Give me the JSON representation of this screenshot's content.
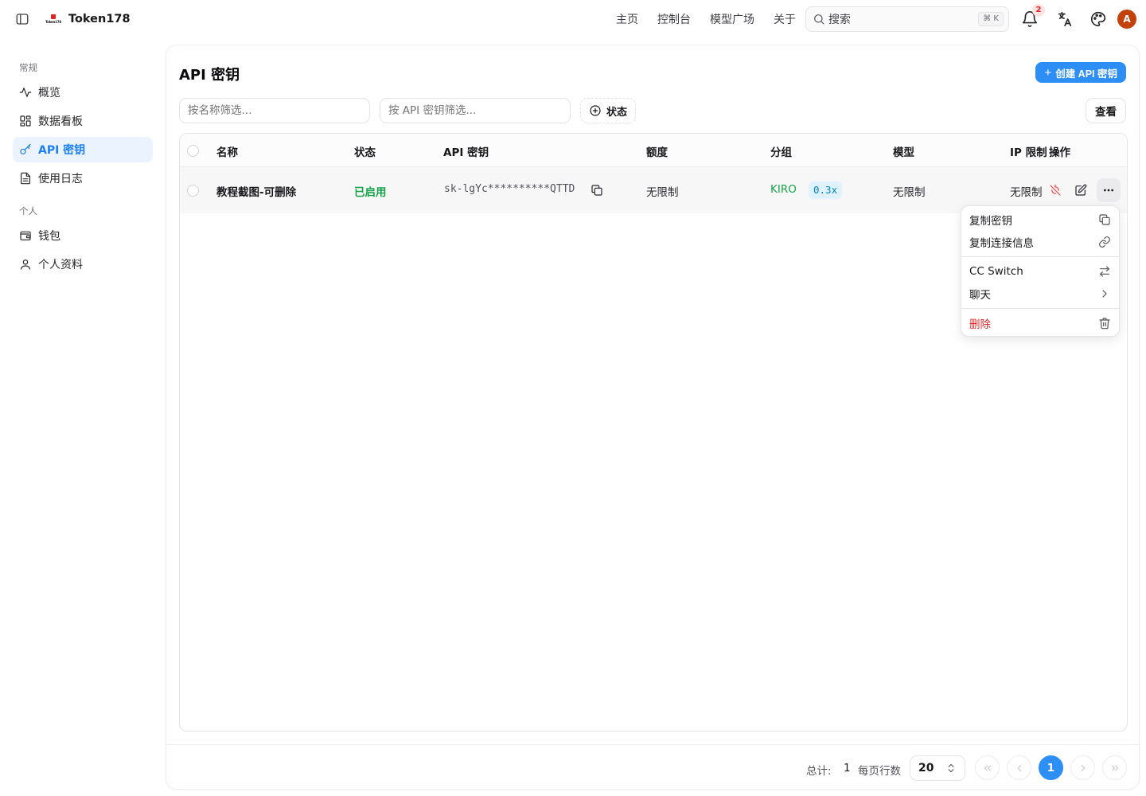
{
  "header": {
    "brand": "Token178",
    "brand_logo_text": "Token178",
    "nav": [
      "主页",
      "控制台",
      "模型广场",
      "关于"
    ],
    "search_placeholder": "搜索",
    "search_shortcut": "⌘ K",
    "notifications_count": "2",
    "avatar_initial": "A"
  },
  "sidebar": {
    "section_general": "常规",
    "section_personal": "个人",
    "items": [
      {
        "label": "概览",
        "icon": "activity-icon"
      },
      {
        "label": "数据看板",
        "icon": "dashboard-icon"
      },
      {
        "label": "API 密钥",
        "icon": "key-icon",
        "active": true
      },
      {
        "label": "使用日志",
        "icon": "file-text-icon"
      },
      {
        "label": "钱包",
        "icon": "wallet-icon"
      },
      {
        "label": "个人资料",
        "icon": "user-icon"
      }
    ]
  },
  "main": {
    "title": "API 密钥",
    "create_button": "创建 API 密钥",
    "filter_name_placeholder": "按名称筛选...",
    "filter_key_placeholder": "按 API 密钥筛选...",
    "status_filter": "状态",
    "view_button": "查看"
  },
  "table": {
    "columns": [
      "名称",
      "状态",
      "API 密钥",
      "额度",
      "分组",
      "模型",
      "IP 限制",
      "操作"
    ],
    "rows": [
      {
        "name": "教程截图-可删除",
        "status": "已启用",
        "key": "sk-lgYc**********QTTD",
        "quota": "无限制",
        "group": "KIRO",
        "ratio": "0.3x",
        "models": "无限制",
        "ip_limit": "无限制"
      }
    ]
  },
  "menu": {
    "items": [
      {
        "label": "复制密钥",
        "icon": "copy-icon"
      },
      {
        "label": "复制连接信息",
        "icon": "link-icon"
      },
      {
        "label": "CC Switch",
        "icon": "switch-arrows-icon"
      },
      {
        "label": "聊天",
        "icon": "chevron-right-icon"
      },
      {
        "label": "删除",
        "icon": "trash-icon"
      }
    ]
  },
  "pagination": {
    "total_label": "总计:",
    "total": "1",
    "rows_label": "每页行数",
    "rows_per_page": "20",
    "current_page": "1"
  },
  "colors": {
    "accent": "#2d8ef5",
    "active_bg": "#eaf3ff",
    "enabled": "#16a34a",
    "danger": "#dc2626"
  }
}
